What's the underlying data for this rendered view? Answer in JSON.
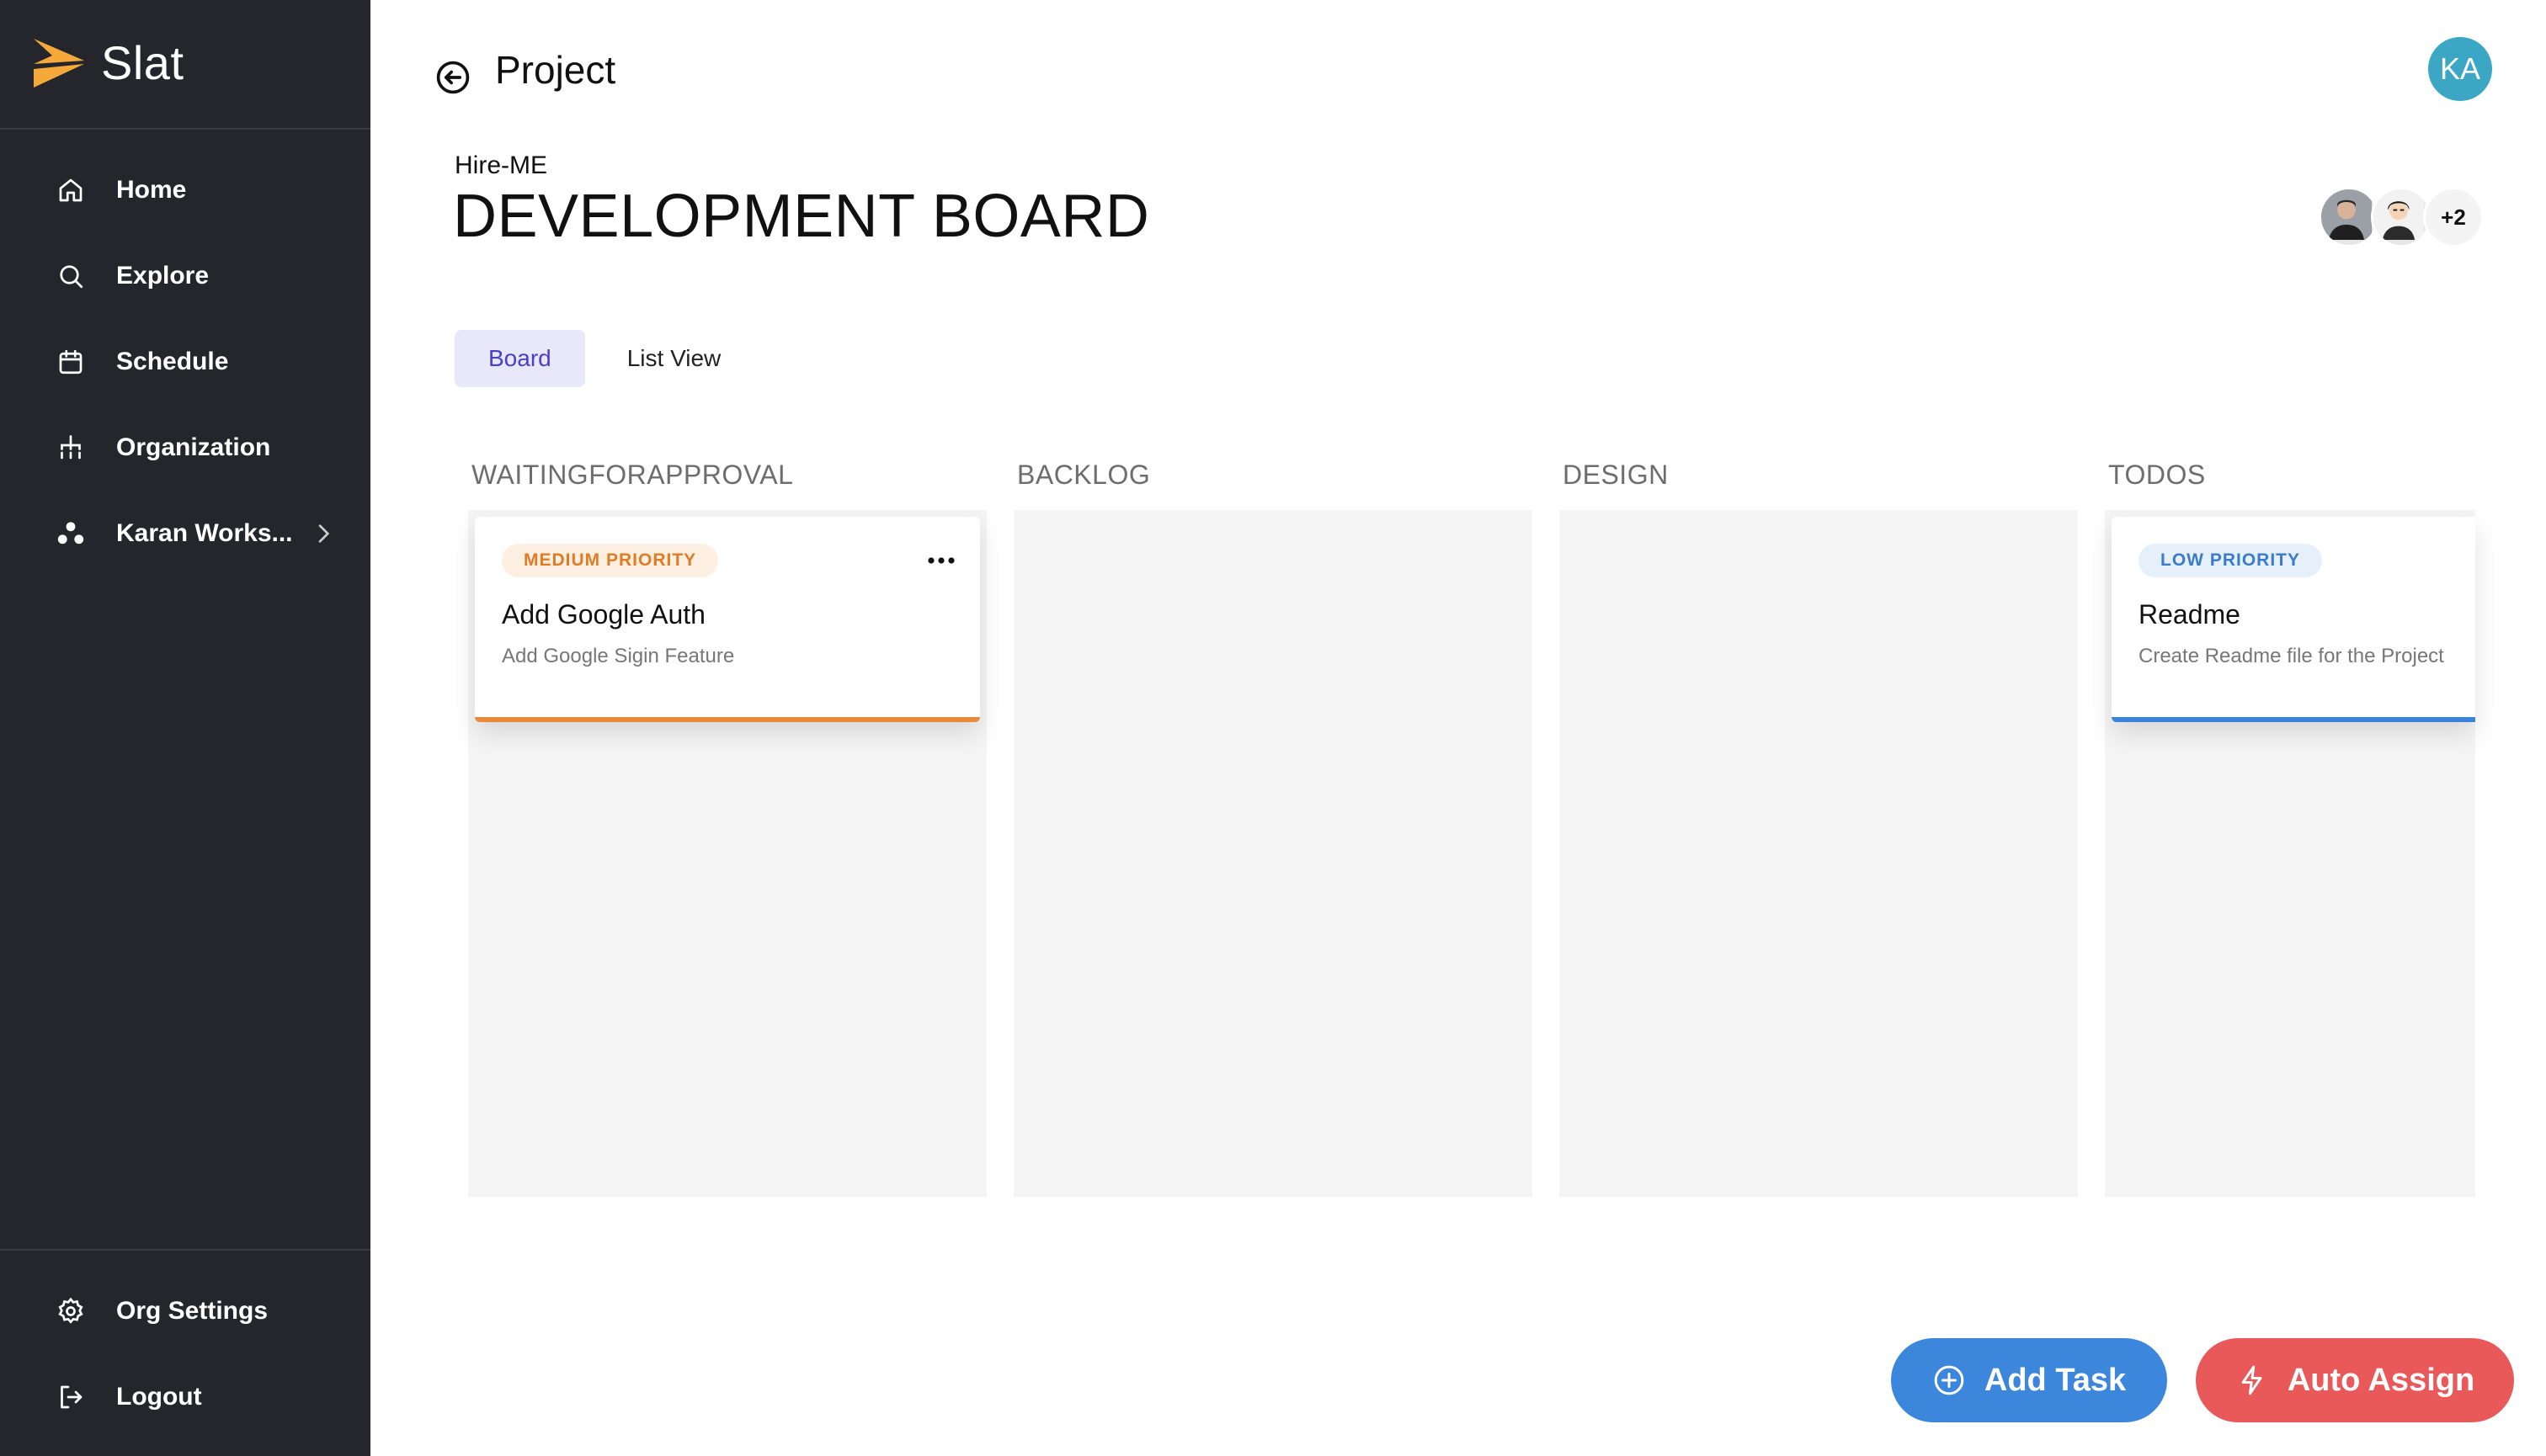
{
  "app": {
    "name": "Slat"
  },
  "sidebar": {
    "items": [
      {
        "label": "Home",
        "icon": "home-icon"
      },
      {
        "label": "Explore",
        "icon": "search-icon"
      },
      {
        "label": "Schedule",
        "icon": "calendar-icon"
      },
      {
        "label": "Organization",
        "icon": "org-chart-icon"
      },
      {
        "label": "Karan Works...",
        "icon": "workspace-icon"
      }
    ],
    "bottom_items": [
      {
        "label": "Org Settings",
        "icon": "gear-icon"
      },
      {
        "label": "Logout",
        "icon": "logout-icon"
      }
    ]
  },
  "header": {
    "title": "Project",
    "user_initials": "KA"
  },
  "project": {
    "workspace": "Hire-ME",
    "name": "DEVELOPMENT BOARD",
    "extra_members": "+2"
  },
  "tabs": [
    {
      "label": "Board",
      "active": true
    },
    {
      "label": "List View",
      "active": false
    }
  ],
  "columns": [
    {
      "title": "WAITINGFORAPPROVAL"
    },
    {
      "title": "BACKLOG"
    },
    {
      "title": "DESIGN"
    },
    {
      "title": "TODOS"
    }
  ],
  "cards": [
    {
      "priority": "MEDIUM PRIORITY",
      "title": "Add Google Auth",
      "description": "Add Google Sigin Feature",
      "accent": "#e98a3a"
    },
    {
      "priority": "LOW PRIORITY",
      "title": "Readme",
      "description": "Create Readme file for the Project",
      "accent": "#3b82d9"
    }
  ],
  "actions": {
    "add_task": "Add Task",
    "auto_assign": "Auto Assign"
  },
  "colors": {
    "sidebar": "#25262b",
    "add_task": "#3c87dc",
    "auto_assign": "#e9595a",
    "logo": "#f4a93a"
  }
}
